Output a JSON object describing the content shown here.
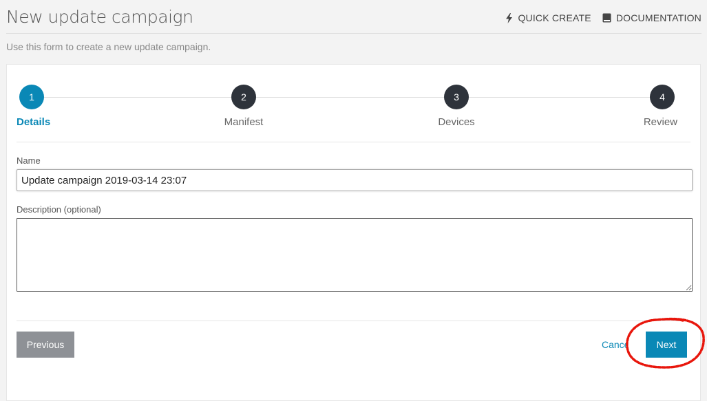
{
  "header": {
    "title": "New update campaign",
    "actions": [
      {
        "label": "QUICK CREATE",
        "icon": "lightning-bolt-icon"
      },
      {
        "label": "DOCUMENTATION",
        "icon": "book-icon"
      }
    ],
    "subtitle": "Use this form to create a new update campaign."
  },
  "stepper": {
    "steps": [
      {
        "number": "1",
        "label": "Details",
        "active": true
      },
      {
        "number": "2",
        "label": "Manifest",
        "active": false
      },
      {
        "number": "3",
        "label": "Devices",
        "active": false
      },
      {
        "number": "4",
        "label": "Review",
        "active": false
      }
    ]
  },
  "form": {
    "name_label": "Name",
    "name_value": "Update campaign 2019-03-14 23:07",
    "description_label": "Description (optional)",
    "description_value": ""
  },
  "footer": {
    "previous_label": "Previous",
    "cancel_label": "Cancel",
    "next_label": "Next"
  },
  "colors": {
    "accent": "#0a88b6",
    "step_inactive": "#2e333b",
    "previous_button": "#8e9196",
    "annotation": "#e8160c"
  }
}
